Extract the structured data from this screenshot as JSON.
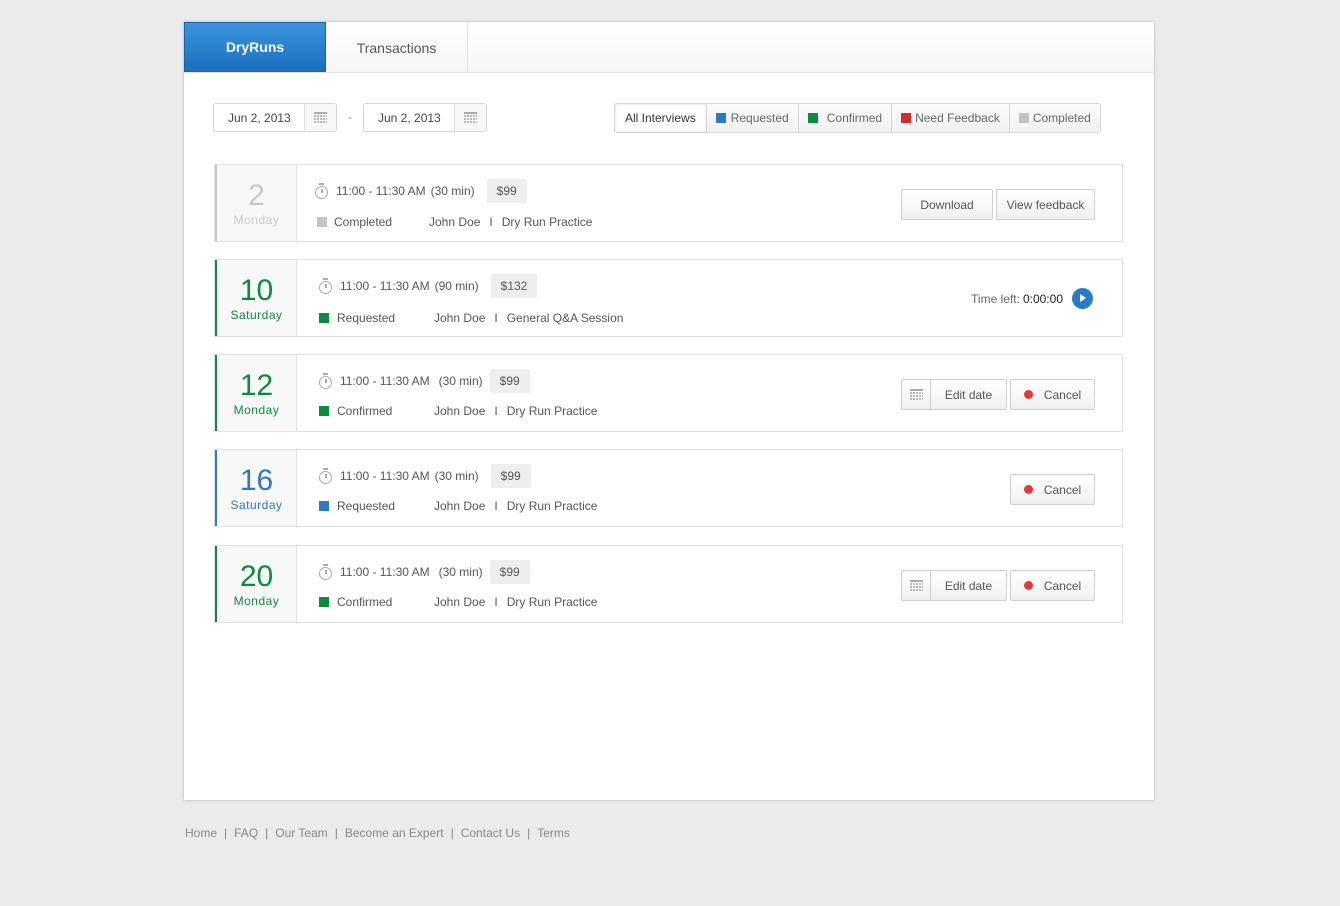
{
  "tabs": [
    {
      "label": "DryRuns",
      "active": true
    },
    {
      "label": "Transactions",
      "active": false
    }
  ],
  "date_range": {
    "from": "Jun 2, 2013",
    "separator": "-",
    "to": "Jun 2, 2013"
  },
  "filters": [
    {
      "label": "All Interviews",
      "color": null,
      "active": true
    },
    {
      "label": "Requested",
      "color": "#2b7bc4"
    },
    {
      "label": "Confirmed",
      "color": "#0d8a3c"
    },
    {
      "label": "Need Feedback",
      "color": "#d42b2b"
    },
    {
      "label": "Completed",
      "color": "#c4c4c4"
    }
  ],
  "interviews": [
    {
      "day_num": "2",
      "day_name": "Monday",
      "accent": "#c8c8c8",
      "time": "11:00 - 11:30 AM",
      "duration": "(30 min)",
      "price": "$99",
      "status": "Completed",
      "status_color": "#c4c4c4",
      "person": "John Doe",
      "divider": "I",
      "topic": "Dry Run Practice",
      "actions": [
        "Download",
        "View feedback"
      ]
    },
    {
      "day_num": "10",
      "day_name": "Saturday",
      "accent": "#0d8a3c",
      "time": "11:00 - 11:30 AM",
      "duration": "(90 min)",
      "price": "$132",
      "status": "Requested",
      "status_color": "#0d8a3c",
      "person": "John Doe",
      "divider": "I",
      "topic": "General Q&A Session",
      "time_left_label": "Time left:",
      "time_left_value": "0:00:00"
    },
    {
      "day_num": "12",
      "day_name": "Monday",
      "accent": "#0d8a3c",
      "time": "11:00 - 11:30 AM",
      "duration": "(30 min)",
      "price": "$99",
      "status": "Confirmed",
      "status_color": "#0d8a3c",
      "person": "John Doe",
      "divider": "I",
      "topic": "Dry Run Practice",
      "edit_label": "Edit date",
      "cancel_label": "Cancel"
    },
    {
      "day_num": "16",
      "day_name": "Saturday",
      "accent": "#2b7bc4",
      "time": "11:00 - 11:30 AM",
      "duration": "(30 min)",
      "price": "$99",
      "status": "Requested",
      "status_color": "#2b7bc4",
      "person": "John Doe",
      "divider": "I",
      "topic": "Dry Run Practice",
      "cancel_label": "Cancel"
    },
    {
      "day_num": "20",
      "day_name": "Monday",
      "accent": "#0d8a3c",
      "time": "11:00 - 11:30 AM",
      "duration": "(30 min)",
      "price": "$99",
      "status": "Confirmed",
      "status_color": "#0d8a3c",
      "person": "John Doe",
      "divider": "I",
      "topic": "Dry Run Practice",
      "edit_label": "Edit date",
      "cancel_label": "Cancel"
    }
  ],
  "footer": {
    "links": [
      "Home",
      "FAQ",
      "Our Team",
      "Become an Expert",
      "Contact Us",
      "Terms"
    ],
    "separator": "|"
  }
}
